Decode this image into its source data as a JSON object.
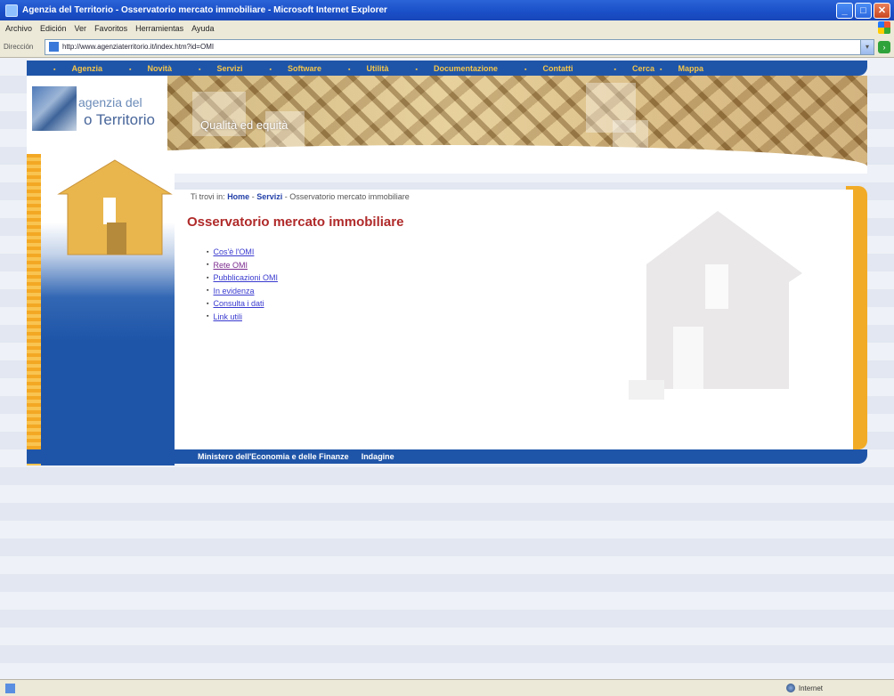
{
  "window": {
    "title": "Agenzia del Territorio - Osservatorio mercato immobiliare - Microsoft Internet Explorer",
    "buttons": [
      "_",
      "□",
      "✕"
    ]
  },
  "menubar": [
    "Archivo",
    "Edición",
    "Ver",
    "Favoritos",
    "Herramientas",
    "Ayuda"
  ],
  "address": {
    "label": "Dirección",
    "url": "http://www.agenziaterritorio.it/index.htm?id=OMI",
    "go": "›"
  },
  "nav": [
    "Agenzia",
    "Novità",
    "Servizi",
    "Software",
    "Utilità",
    "Documentazione",
    "Contatti",
    "Cerca",
    "Mappa"
  ],
  "logo": {
    "line1": "agenzia del",
    "line2": "o Territorio"
  },
  "tagline": "Qualità ed equità",
  "breadcrumb": {
    "prefix": "Ti trovi in:",
    "home": "Home",
    "sep1": " - ",
    "servizi": "Servizi",
    "sep2": " - ",
    "current": "Osservatorio mercato immobiliare"
  },
  "page_title": "Osservatorio mercato immobiliare",
  "links": [
    "Cos'è l'OMI",
    "Rete OMI",
    "Pubblicazioni OMI",
    "In evidenza",
    "Consulta i dati",
    "Link utili"
  ],
  "footer": [
    "Ministero dell'Economia e delle Finanze",
    "Indagine"
  ],
  "status": {
    "zone": "Internet"
  },
  "colors": {
    "nav_blue": "#1f55a8",
    "accent_orange": "#f2ab26",
    "title_red": "#b02a2a"
  }
}
